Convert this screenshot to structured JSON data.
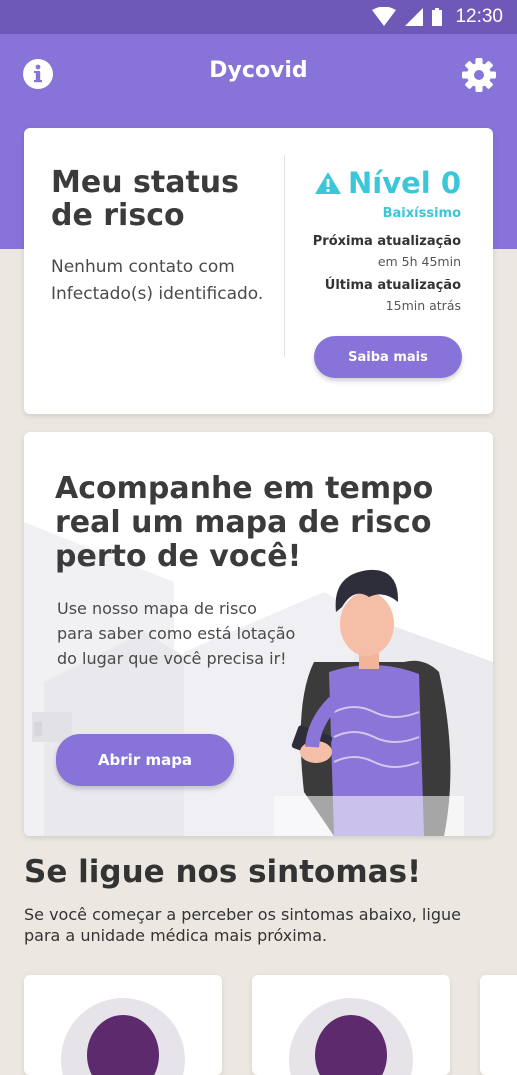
{
  "status_bar": {
    "time": "12:30"
  },
  "app": {
    "title": "Dycovid",
    "info_icon": "info-icon",
    "settings_icon": "gear-icon",
    "accent": "#8874d8"
  },
  "risk_card": {
    "title": "Meu status de risco",
    "description": "Nenhum contato com Infectado(s) identificado.",
    "level": "Nível 0",
    "level_sub": "Baixíssimo",
    "level_color": "#3cc7d8",
    "next_update_label": "Próxima atualização",
    "next_update_value": "em 5h 45min",
    "last_update_label": "Última atualização",
    "last_update_value": "15min atrás",
    "button": "Saiba mais"
  },
  "map_card": {
    "title": "Acompanhe em tempo real um  mapa de risco perto de você!",
    "description": "Use nosso mapa de risco para saber como está lotação do lugar que você precisa ir!",
    "button": "Abrir mapa"
  },
  "symptoms": {
    "title": "Se ligue nos sintomas!",
    "description": "Se você começar a perceber os sintomas abaixo, ligue para a unidade médica mais próxima."
  }
}
